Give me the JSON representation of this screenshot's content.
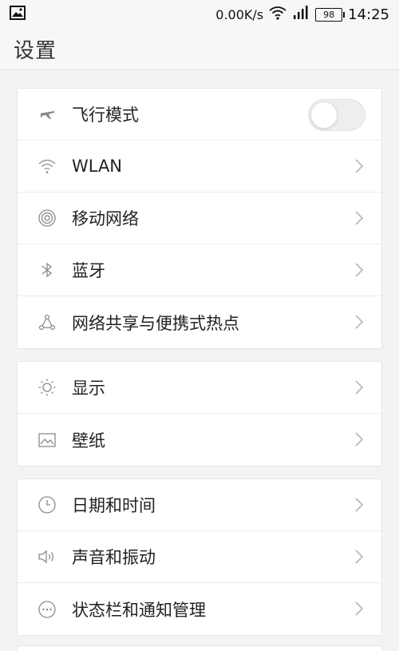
{
  "status_bar": {
    "speed": "0.00K/s",
    "battery": "98",
    "time": "14:25"
  },
  "header": {
    "title": "设置"
  },
  "groups": [
    {
      "items": [
        {
          "label": "飞行模式",
          "icon": "airplane-icon",
          "control": "toggle",
          "toggle_on": false
        },
        {
          "label": "WLAN",
          "icon": "wifi-icon",
          "control": "chevron"
        },
        {
          "label": "移动网络",
          "icon": "mobile-network-icon",
          "control": "chevron"
        },
        {
          "label": "蓝牙",
          "icon": "bluetooth-icon",
          "control": "chevron"
        },
        {
          "label": "网络共享与便携式热点",
          "icon": "hotspot-icon",
          "control": "chevron"
        }
      ]
    },
    {
      "items": [
        {
          "label": "显示",
          "icon": "brightness-icon",
          "control": "chevron"
        },
        {
          "label": "壁纸",
          "icon": "wallpaper-icon",
          "control": "chevron"
        }
      ]
    },
    {
      "items": [
        {
          "label": "日期和时间",
          "icon": "clock-icon",
          "control": "chevron"
        },
        {
          "label": "声音和振动",
          "icon": "speaker-icon",
          "control": "chevron"
        },
        {
          "label": "状态栏和通知管理",
          "icon": "more-dots-icon",
          "control": "chevron"
        }
      ]
    }
  ],
  "colors": {
    "background": "#f3f3f3",
    "card": "#ffffff",
    "icon": "#8a8a8a",
    "chevron": "#b5b5b5",
    "text": "#222222"
  }
}
